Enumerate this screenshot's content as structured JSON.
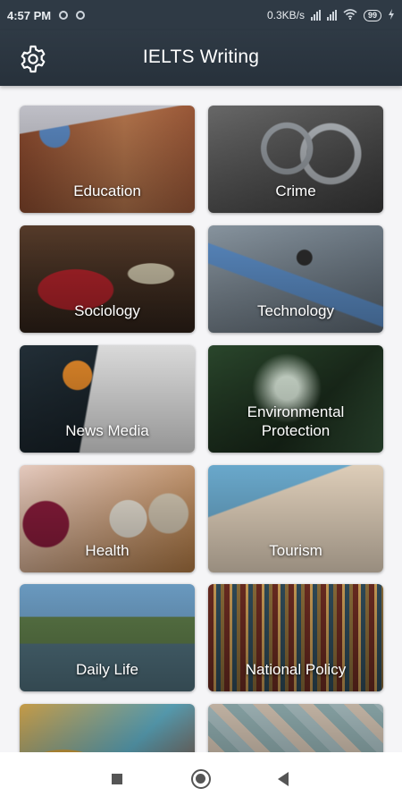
{
  "status_bar": {
    "time": "4:57 PM",
    "network_speed": "0.3KB/s",
    "battery": "99"
  },
  "app_bar": {
    "title": "IELTS Writing",
    "settings_icon": "gear-icon"
  },
  "categories": [
    {
      "label": "Education"
    },
    {
      "label": "Crime"
    },
    {
      "label": "Sociology"
    },
    {
      "label": "Technology"
    },
    {
      "label": "News Media"
    },
    {
      "label": "Environmental\nProtection"
    },
    {
      "label": "Health"
    },
    {
      "label": "Tourism"
    },
    {
      "label": "Daily Life"
    },
    {
      "label": "National Policy"
    },
    {
      "label": ""
    },
    {
      "label": ""
    }
  ],
  "nav_bar": {
    "icons": [
      "recent-apps-icon",
      "home-icon",
      "back-icon"
    ]
  }
}
